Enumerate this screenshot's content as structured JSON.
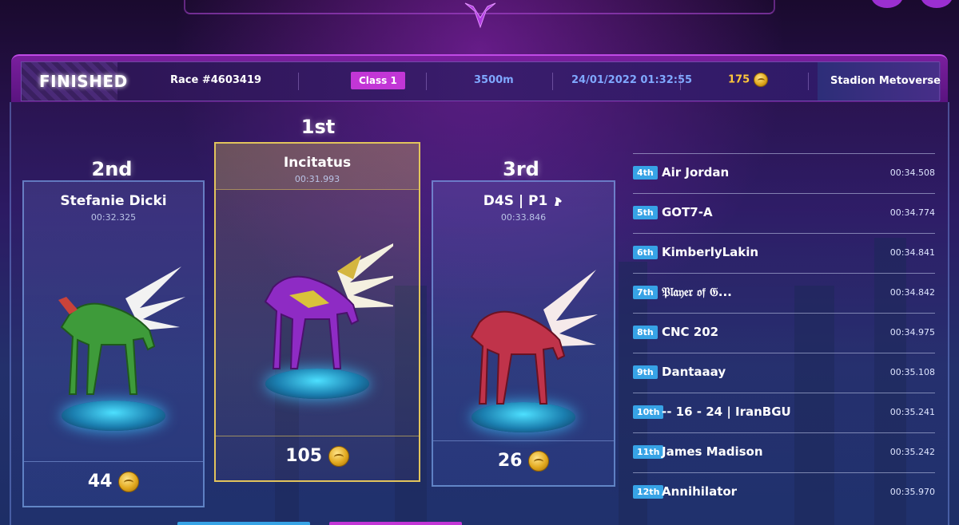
{
  "header": {
    "status": "FINISHED",
    "race": "Race #4603419",
    "class": "Class 1",
    "distance": "3500m",
    "datetime": "24/01/2022 01:32:55",
    "prize": "175",
    "venue": "Stadion Metoverse"
  },
  "podium": {
    "first": {
      "place": "1st",
      "name": "Incitatus",
      "time": "00:31.993",
      "reward": "105"
    },
    "second": {
      "place": "2nd",
      "name": "Stefanie Dicki",
      "time": "00:32.325",
      "reward": "44"
    },
    "third": {
      "place": "3rd",
      "name": "D4S   |  P1",
      "time": "00:33.846",
      "reward": "26"
    }
  },
  "leaderboard": [
    {
      "rank": "4th",
      "name": "Air Jordan",
      "time": "00:34.508"
    },
    {
      "rank": "5th",
      "name": "GOT7-A",
      "time": "00:34.774"
    },
    {
      "rank": "6th",
      "name": "KimberlyLakin",
      "time": "00:34.841"
    },
    {
      "rank": "7th",
      "name": "𝔓𝔩𝔞𝔶𝔢𝔯 𝔬𝔣 𝔊...",
      "time": "00:34.842"
    },
    {
      "rank": "8th",
      "name": "CNC 202",
      "time": "00:34.975"
    },
    {
      "rank": "9th",
      "name": "Dantaaay",
      "time": "00:35.108"
    },
    {
      "rank": "10th",
      "name": "-- 16 - 24 | IranBGU",
      "time": "00:35.241"
    },
    {
      "rank": "11th",
      "name": "James Madison",
      "time": "00:35.242"
    },
    {
      "rank": "12th",
      "name": "Annihilator",
      "time": "00:35.970"
    }
  ],
  "colors": {
    "accent": "#c236d6",
    "rank_badge": "#37a3e6",
    "gold": "#ffc83a"
  },
  "icons": {
    "prize": "coin-icon",
    "emblem": "guild-emblem-icon",
    "horse": "horse-head-icon"
  }
}
